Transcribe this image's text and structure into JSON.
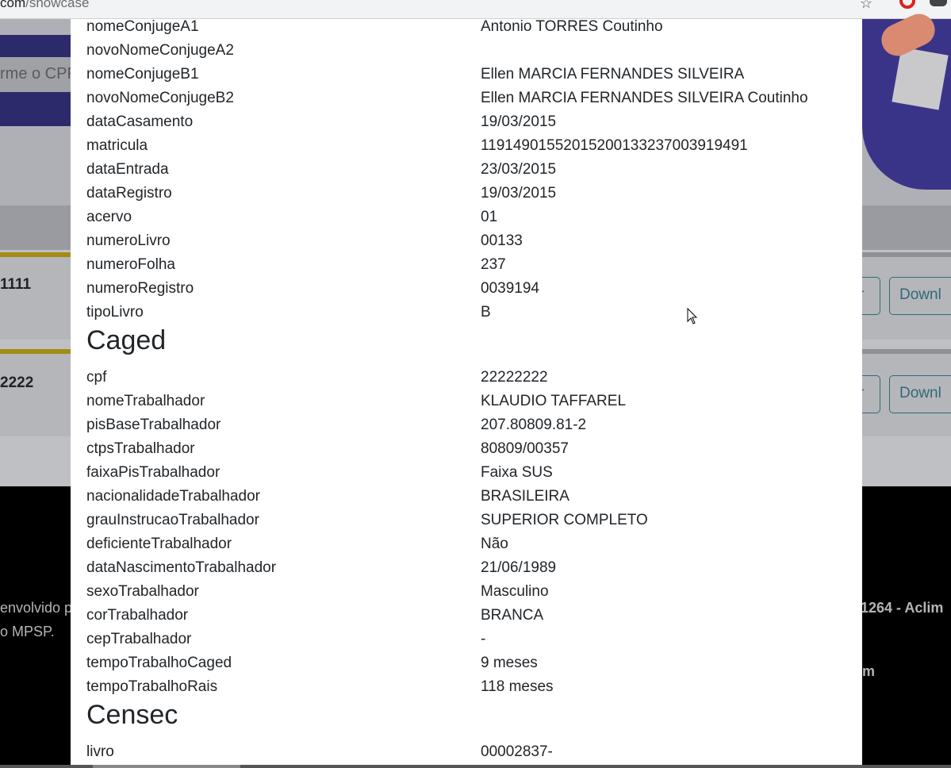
{
  "browser": {
    "url_prefix": "com",
    "url_path": "/showcase"
  },
  "background": {
    "cpf_placeholder": "rme o CPF",
    "card1_number": "1111",
    "card2_number": "2222",
    "view_button": "r",
    "download_button": "Downl",
    "footer_text_1": "envolvido p",
    "footer_text_2": "o MPSP.",
    "footer_text_3": "1264 - Aclim",
    "footer_text_4": "m"
  },
  "modal": {
    "rows_top": [
      {
        "key": "nomeConjugeA1",
        "value": "Antonio TORRES Coutinho"
      },
      {
        "key": "novoNomeConjugeA2",
        "value": ""
      },
      {
        "key": "nomeConjugeB1",
        "value": "Ellen MARCIA FERNANDES SILVEIRA"
      },
      {
        "key": "novoNomeConjugeB2",
        "value": "Ellen MARCIA FERNANDES SILVEIRA Coutinho"
      },
      {
        "key": "dataCasamento",
        "value": "19/03/2015"
      },
      {
        "key": "matricula",
        "value": "119149015520152001332370039194​91"
      },
      {
        "key": "dataEntrada",
        "value": "23/03/2015"
      },
      {
        "key": "dataRegistro",
        "value": "19/03/2015"
      },
      {
        "key": "acervo",
        "value": "01"
      },
      {
        "key": "numeroLivro",
        "value": "00133"
      },
      {
        "key": "numeroFolha",
        "value": "237"
      },
      {
        "key": "numeroRegistro",
        "value": "0039194"
      },
      {
        "key": "tipoLivro",
        "value": "B"
      }
    ],
    "section_caged": "Caged",
    "rows_caged": [
      {
        "key": "cpf",
        "value": "22222222"
      },
      {
        "key": "nomeTrabalhador",
        "value": "KLAUDIO TAFFAREL"
      },
      {
        "key": "pisBaseTrabalhador",
        "value": "207.80809.81-2"
      },
      {
        "key": "ctpsTrabalhador",
        "value": "80809/00357"
      },
      {
        "key": "faixaPisTrabalhador",
        "value": "Faixa SUS"
      },
      {
        "key": "nacionalidadeTrabalhador",
        "value": "BRASILEIRA"
      },
      {
        "key": "grauInstrucaoTrabalhador",
        "value": "SUPERIOR COMPLETO"
      },
      {
        "key": "deficienteTrabalhador",
        "value": "Não"
      },
      {
        "key": "dataNascimentoTrabalhador",
        "value": "21/06/1989"
      },
      {
        "key": "sexoTrabalhador",
        "value": "Masculino"
      },
      {
        "key": "corTrabalhador",
        "value": "BRANCA"
      },
      {
        "key": "cepTrabalhador",
        "value": "-"
      },
      {
        "key": "tempoTrabalhoCaged",
        "value": "9 meses"
      },
      {
        "key": "tempoTrabalhoRais",
        "value": "118 meses"
      }
    ],
    "section_censec": "Censec",
    "rows_censec": [
      {
        "key": "livro",
        "value": "00002837-"
      }
    ]
  }
}
